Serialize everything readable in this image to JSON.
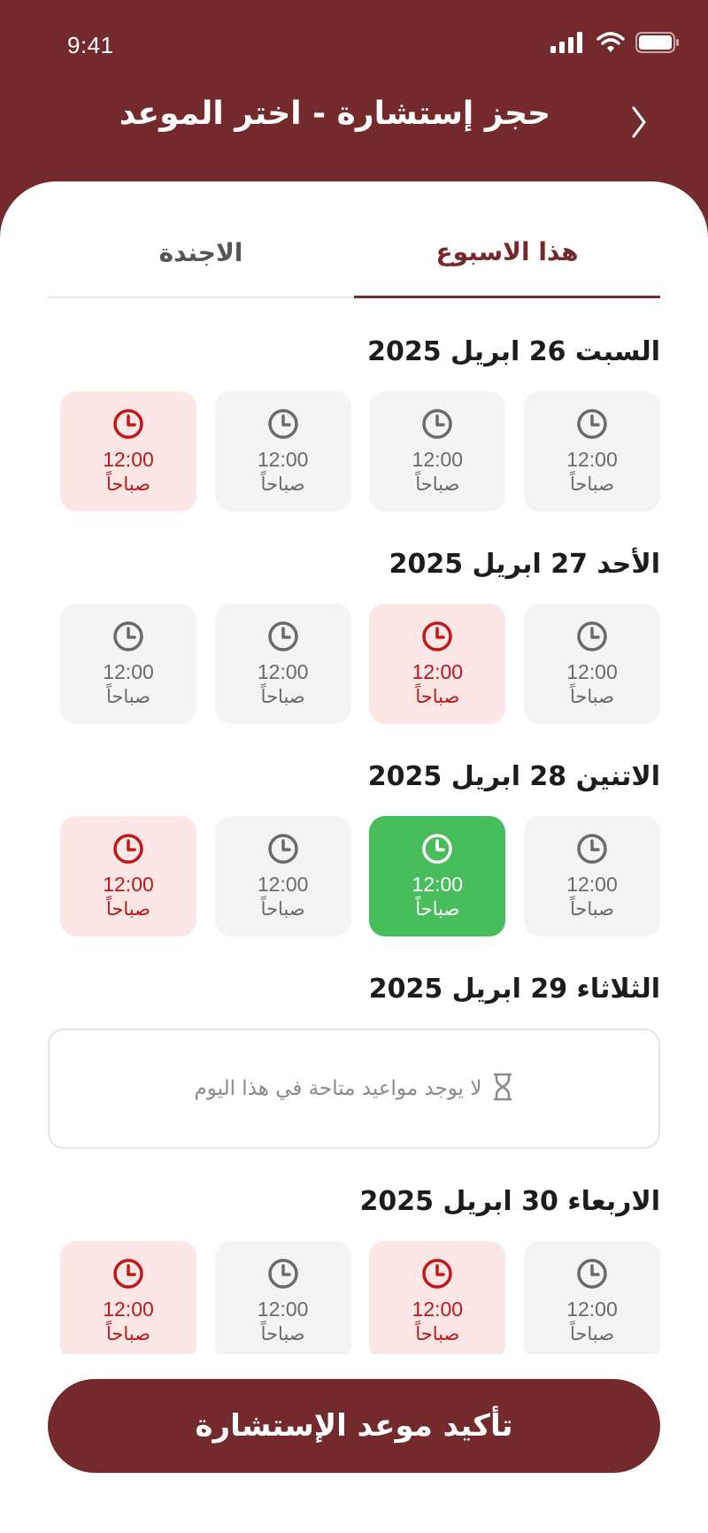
{
  "status_bar": {
    "time": "9:41"
  },
  "header": {
    "title": "حجز إستشارة - اختر الموعد"
  },
  "tabs": [
    {
      "label": "هذا الاسبوع",
      "active": true
    },
    {
      "label": "الاجندة",
      "active": false
    }
  ],
  "days": [
    {
      "title": "السبت 26 ابريل 2025",
      "slots": [
        {
          "time": "12:00",
          "period": "صباحاً",
          "state": "available"
        },
        {
          "time": "12:00",
          "period": "صباحاً",
          "state": "available"
        },
        {
          "time": "12:00",
          "period": "صباحاً",
          "state": "available"
        },
        {
          "time": "12:00",
          "period": "صباحاً",
          "state": "booked"
        }
      ]
    },
    {
      "title": "الأحد 27 ابريل 2025",
      "slots": [
        {
          "time": "12:00",
          "period": "صباحاً",
          "state": "available"
        },
        {
          "time": "12:00",
          "period": "صباحاً",
          "state": "booked"
        },
        {
          "time": "12:00",
          "period": "صباحاً",
          "state": "available"
        },
        {
          "time": "12:00",
          "period": "صباحاً",
          "state": "available"
        }
      ]
    },
    {
      "title": "الاتنين 28 ابريل 2025",
      "slots": [
        {
          "time": "12:00",
          "period": "صباحاً",
          "state": "available"
        },
        {
          "time": "12:00",
          "period": "صباحاً",
          "state": "selected"
        },
        {
          "time": "12:00",
          "period": "صباحاً",
          "state": "available"
        },
        {
          "time": "12:00",
          "period": "صباحاً",
          "state": "booked"
        }
      ]
    },
    {
      "title": "الثلاثاء 29 ابريل 2025",
      "empty_message": "لا يوجد مواعيد متاحة في هذا اليوم"
    },
    {
      "title": "الاربعاء 30 ابريل 2025",
      "slots": [
        {
          "time": "12:00",
          "period": "صباحاً",
          "state": "available"
        },
        {
          "time": "12:00",
          "period": "صباحاً",
          "state": "booked"
        },
        {
          "time": "12:00",
          "period": "صباحاً",
          "state": "available"
        },
        {
          "time": "12:00",
          "period": "صباحاً",
          "state": "booked"
        }
      ]
    }
  ],
  "confirm_button": {
    "label": "تأكيد موعد الإستشارة"
  },
  "colors": {
    "brand": "#742A2D",
    "selected": "#47BD5C",
    "booked_bg": "#FCE6E6",
    "booked_text": "#C01818",
    "available_bg": "#F4F4F4"
  },
  "icons": {
    "slot": "clock-icon",
    "empty": "hourglass-icon",
    "back": "chevron-right-icon"
  }
}
